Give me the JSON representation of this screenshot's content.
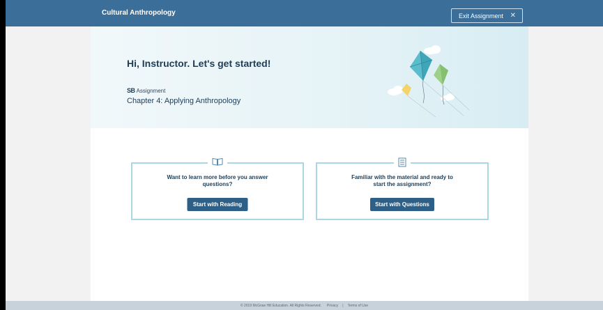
{
  "header": {
    "app_title": "Cultural Anthropology",
    "exit_label": "Exit Assignment",
    "exit_icon": "close-icon"
  },
  "hero": {
    "greeting": "Hi, Instructor. Let's get started!",
    "logo_text": "SB",
    "assignment_label": "Assignment",
    "chapter": "Chapter 4: Applying Anthropology"
  },
  "cards": [
    {
      "icon": "book-icon",
      "prompt": "Want to learn more before you answer questions?",
      "button_label": "Start with Reading"
    },
    {
      "icon": "list-icon",
      "prompt": "Familiar with the material and ready to start the assignment?",
      "button_label": "Start with Questions"
    }
  ],
  "footer": {
    "copyright": "© 2019 McGraw Hill Education. All Rights Reserved.",
    "privacy": "Privacy",
    "separator": "|",
    "terms": "Terms of Use"
  },
  "colors": {
    "topbar": "#3b6f9a",
    "button": "#2e5f86",
    "card_border": "#a9d8e4",
    "heading": "#1e3d55"
  }
}
